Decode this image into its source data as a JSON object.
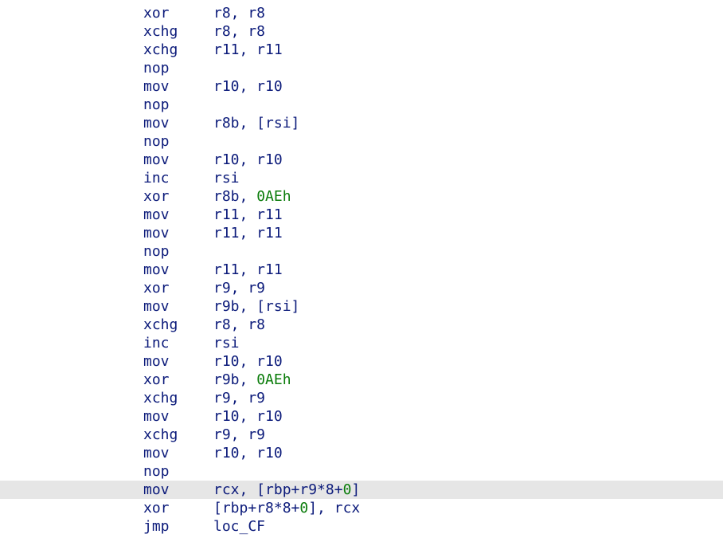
{
  "colors": {
    "text": "#0b1a7a",
    "number": "#0a7c0a",
    "selection": "#e6e6e6",
    "background": "#ffffff"
  },
  "selected_index": 26,
  "lines": [
    {
      "mnemonic": "xor",
      "operands": [
        {
          "t": "r8, r8"
        }
      ]
    },
    {
      "mnemonic": "xchg",
      "operands": [
        {
          "t": "r8, r8"
        }
      ]
    },
    {
      "mnemonic": "xchg",
      "operands": [
        {
          "t": "r11, r11"
        }
      ]
    },
    {
      "mnemonic": "nop",
      "operands": []
    },
    {
      "mnemonic": "mov",
      "operands": [
        {
          "t": "r10, r10"
        }
      ]
    },
    {
      "mnemonic": "nop",
      "operands": []
    },
    {
      "mnemonic": "mov",
      "operands": [
        {
          "t": "r8b, [rsi]"
        }
      ]
    },
    {
      "mnemonic": "nop",
      "operands": []
    },
    {
      "mnemonic": "mov",
      "operands": [
        {
          "t": "r10, r10"
        }
      ]
    },
    {
      "mnemonic": "inc",
      "operands": [
        {
          "t": "rsi"
        }
      ]
    },
    {
      "mnemonic": "xor",
      "operands": [
        {
          "t": "r8b, "
        },
        {
          "t": "0AEh",
          "num": true
        }
      ]
    },
    {
      "mnemonic": "mov",
      "operands": [
        {
          "t": "r11, r11"
        }
      ]
    },
    {
      "mnemonic": "mov",
      "operands": [
        {
          "t": "r11, r11"
        }
      ]
    },
    {
      "mnemonic": "nop",
      "operands": []
    },
    {
      "mnemonic": "mov",
      "operands": [
        {
          "t": "r11, r11"
        }
      ]
    },
    {
      "mnemonic": "xor",
      "operands": [
        {
          "t": "r9, r9"
        }
      ]
    },
    {
      "mnemonic": "mov",
      "operands": [
        {
          "t": "r9b, [rsi]"
        }
      ]
    },
    {
      "mnemonic": "xchg",
      "operands": [
        {
          "t": "r8, r8"
        }
      ]
    },
    {
      "mnemonic": "inc",
      "operands": [
        {
          "t": "rsi"
        }
      ]
    },
    {
      "mnemonic": "mov",
      "operands": [
        {
          "t": "r10, r10"
        }
      ]
    },
    {
      "mnemonic": "xor",
      "operands": [
        {
          "t": "r9b, "
        },
        {
          "t": "0AEh",
          "num": true
        }
      ]
    },
    {
      "mnemonic": "xchg",
      "operands": [
        {
          "t": "r9, r9"
        }
      ]
    },
    {
      "mnemonic": "mov",
      "operands": [
        {
          "t": "r10, r10"
        }
      ]
    },
    {
      "mnemonic": "xchg",
      "operands": [
        {
          "t": "r9, r9"
        }
      ]
    },
    {
      "mnemonic": "mov",
      "operands": [
        {
          "t": "r10, r10"
        }
      ]
    },
    {
      "mnemonic": "nop",
      "operands": []
    },
    {
      "mnemonic": "mov",
      "operands": [
        {
          "t": "rcx, [rbp+r9*8+"
        },
        {
          "t": "0",
          "num": true
        },
        {
          "t": "]"
        }
      ]
    },
    {
      "mnemonic": "xor",
      "operands": [
        {
          "t": "[rbp+r8*8+"
        },
        {
          "t": "0",
          "num": true
        },
        {
          "t": "], rcx"
        }
      ]
    },
    {
      "mnemonic": "jmp",
      "operands": [
        {
          "t": "loc_CF"
        }
      ]
    }
  ]
}
